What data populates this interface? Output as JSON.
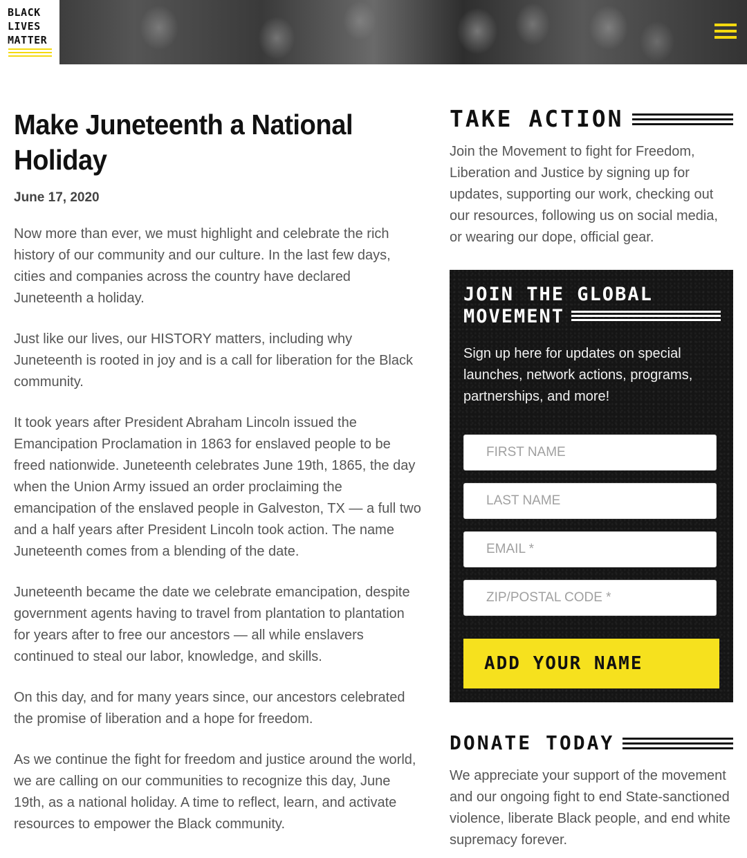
{
  "header": {
    "logo_lines": [
      "BLACK",
      "LIVES",
      "MATTER"
    ],
    "menu_icon": "hamburger-menu-icon",
    "accent_color": "#f4d90f"
  },
  "article": {
    "title": "Make Juneteenth a National Holiday",
    "date": "June 17, 2020",
    "paragraphs": [
      "Now more than ever, we must highlight and celebrate the rich history of our community and our culture. In the last few days, cities and companies across the country have declared Juneteenth a holiday.",
      "Just like our lives, our HISTORY matters, including why Juneteenth is rooted in joy and is a call for liberation for the Black community.",
      "It took years after President Abraham Lincoln issued the Emancipation Proclamation in 1863 for enslaved people to be freed nationwide. Juneteenth celebrates June 19th, 1865, the day when the Union Army issued an order proclaiming the emancipation of the enslaved people in Galveston, TX — a full two and a half years after President Lincoln took action. The name Juneteenth comes from a blending of the date.",
      "Juneteenth became the date we celebrate emancipation, despite government agents having to travel from plantation to plantation for years after to free our ancestors — all while enslavers continued to steal our labor, knowledge, and skills.",
      "On this day, and for many years since, our ancestors celebrated the promise of liberation and a hope for freedom.",
      "As we continue the fight for freedom and justice around the world, we are calling on our communities to recognize this day, June 19th, as a national holiday. A time to reflect, learn, and activate resources to empower the Black community."
    ]
  },
  "sidebar": {
    "take_action": {
      "heading": "TAKE ACTION",
      "text": "Join the Movement to fight for Freedom, Liberation and Justice by signing up for updates, supporting our work, checking out our resources, following us on social media, or wearing our dope, official gear."
    },
    "join": {
      "heading_line1": "JOIN THE GLOBAL",
      "heading_line2": "MOVEMENT",
      "text": "Sign up here for updates on special launches, network actions, programs, partnerships, and more!",
      "first_name_placeholder": "FIRST NAME",
      "last_name_placeholder": "LAST NAME",
      "email_placeholder": "EMAIL *",
      "zip_placeholder": "ZIP/POSTAL CODE *",
      "submit_label": "ADD YOUR NAME",
      "button_color": "#f6e11e"
    },
    "donate": {
      "heading": "DONATE TODAY",
      "text": "We appreciate your support of the movement and our ongoing fight to end State-sanctioned violence, liberate Black people, and end white supremacy forever."
    }
  }
}
